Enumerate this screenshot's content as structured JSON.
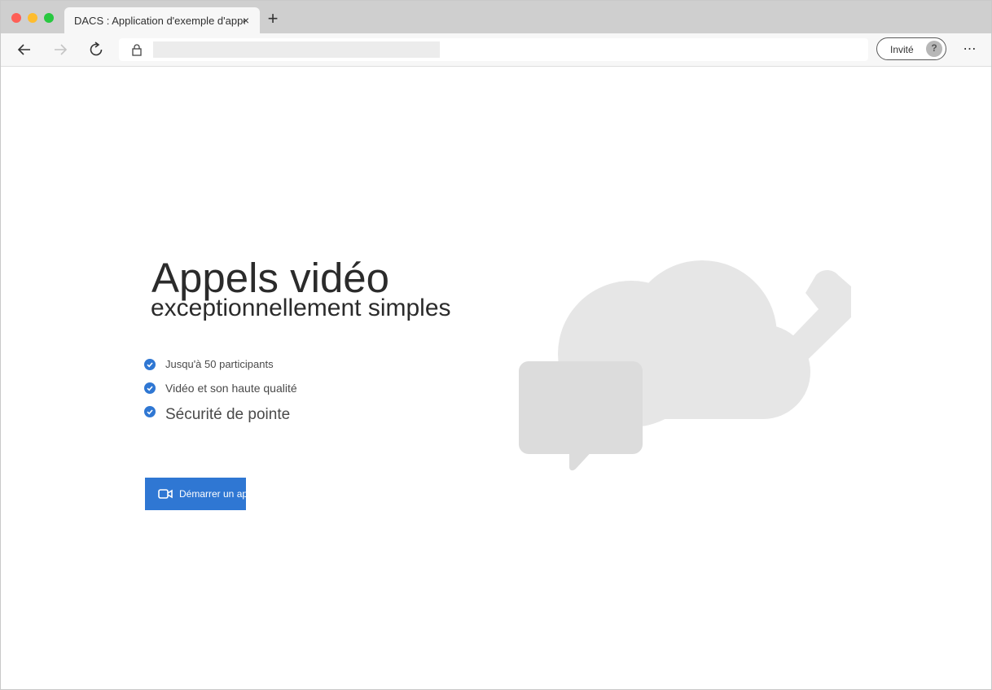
{
  "browser": {
    "tab_title": "DACS : Application d'exemple d'appel",
    "tab_close_glyph": "×",
    "new_tab_glyph": "+",
    "profile_label": "Invité",
    "avatar_glyph": "?",
    "more_glyph": "⋯",
    "icons": {
      "back": "back-arrow-icon",
      "forward": "forward-arrow-icon",
      "reload": "reload-icon",
      "lock": "lock-icon",
      "more": "more-options-icon"
    }
  },
  "hero": {
    "title": "Appels vidéo",
    "subtitle": "exceptionnellement simples",
    "features": [
      "Jusqu'à 50 participants",
      "Vidéo et son haute qualité",
      "Sécurité de pointe"
    ],
    "start_button_label": "Démarrer un appel"
  },
  "colors": {
    "accent": "#2f77d3",
    "illustration": "#e6e6e6"
  }
}
